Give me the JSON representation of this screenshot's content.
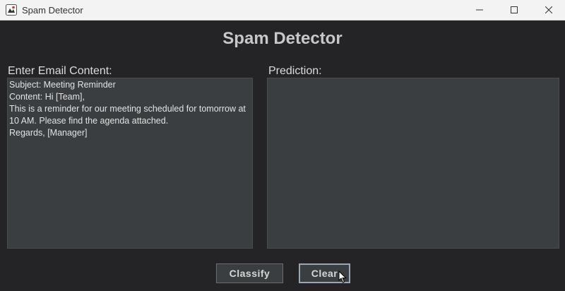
{
  "window": {
    "title": "Spam Detector",
    "icon": "java-app-icon",
    "controls": [
      "minimize-icon",
      "maximize-icon",
      "close-icon"
    ]
  },
  "app": {
    "heading": "Spam Detector"
  },
  "email_panel": {
    "label": "Enter Email Content:",
    "value": "Subject: Meeting Reminder\nContent: Hi [Team],\nThis is a reminder for our meeting scheduled for tomorrow at 10 AM. Please find the agenda attached.\nRegards, [Manager]"
  },
  "prediction_panel": {
    "label": "Prediction:",
    "value": ""
  },
  "buttons": {
    "classify": "Classify",
    "clear": "Clear"
  },
  "colors": {
    "background": "#242427",
    "text_area": "#3b3e40",
    "heading": "#c8c8c8",
    "focus_border": "#9aa6b4"
  }
}
